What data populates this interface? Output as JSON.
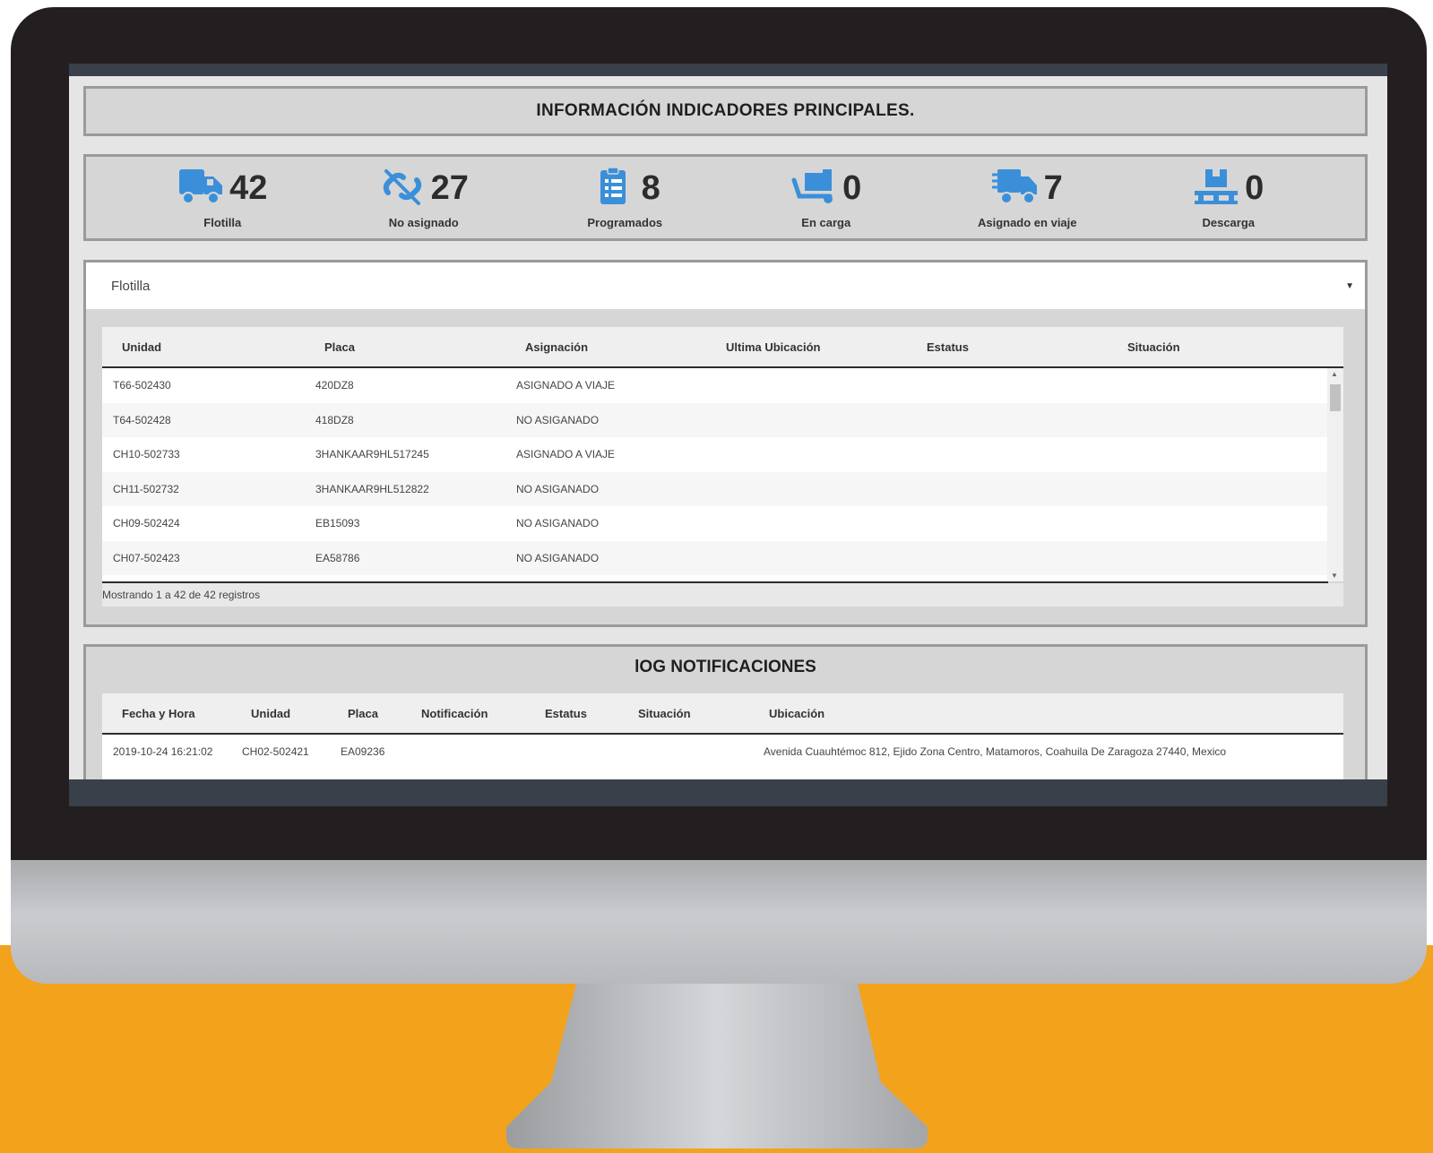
{
  "header": {
    "title": "INFORMACIÓN INDICADORES PRINCIPALES."
  },
  "stats": [
    {
      "icon": "truck-icon",
      "value": "42",
      "label": "Flotilla"
    },
    {
      "icon": "unlink-icon",
      "value": "27",
      "label": "No asignado"
    },
    {
      "icon": "clipboard-list-icon",
      "value": "8",
      "label": "Programados"
    },
    {
      "icon": "dolly-loading-icon",
      "value": "0",
      "label": "En carga"
    },
    {
      "icon": "truck-moving-icon",
      "value": "7",
      "label": "Asignado en viaje"
    },
    {
      "icon": "pallet-unload-icon",
      "value": "0",
      "label": "Descarga"
    }
  ],
  "fleet_select": {
    "selected": "Flotilla"
  },
  "fleet_table": {
    "columns": [
      "Unidad",
      "Placa",
      "Asignación",
      "Ultima Ubicación",
      "Estatus",
      "Situación"
    ],
    "rows": [
      [
        "T66-502430",
        "420DZ8",
        "ASIGNADO A VIAJE",
        "",
        "",
        ""
      ],
      [
        "T64-502428",
        "418DZ8",
        "NO ASIGANADO",
        "",
        "",
        ""
      ],
      [
        "CH10-502733",
        "3HANKAAR9HL517245",
        "ASIGNADO A VIAJE",
        "",
        "",
        ""
      ],
      [
        "CH11-502732",
        "3HANKAAR9HL512822",
        "NO ASIGANADO",
        "",
        "",
        ""
      ],
      [
        "CH09-502424",
        "EB15093",
        "NO ASIGANADO",
        "",
        "",
        ""
      ],
      [
        "CH07-502423",
        "EA58786",
        "NO ASIGANADO",
        "",
        "",
        ""
      ]
    ],
    "footer": "Mostrando 1 a 42 de 42 registros"
  },
  "log": {
    "title": "lOG NOTIFICACIONES",
    "columns": [
      "Fecha y Hora",
      "Unidad",
      "Placa",
      "Notificación",
      "Estatus",
      "Situación",
      "Ubicación"
    ],
    "rows": [
      [
        "2019-10-24 16:21:02",
        "CH02-502421",
        "EA09236",
        "",
        "",
        "",
        "Avenida Cuauhtémoc 812, Ejido Zona Centro, Matamoros, Coahuila De Zaragoza 27440, Mexico"
      ]
    ]
  },
  "colors": {
    "accent": "#3b8fd9",
    "brand_orange": "#f3a21c",
    "bezel": "#231f20"
  }
}
